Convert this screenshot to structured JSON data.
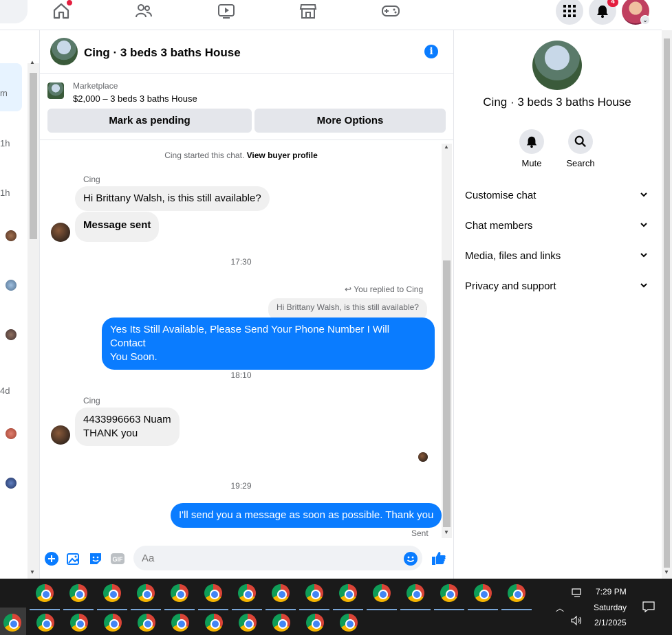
{
  "topnav": {
    "notification_count": "4",
    "icons": [
      "home-icon",
      "friends-icon",
      "watch-icon",
      "marketplace-icon",
      "gaming-icon",
      "menu-grid-icon",
      "bell-icon",
      "profile-avatar"
    ]
  },
  "left_list": {
    "times": [
      "m",
      "1h",
      "1h",
      "4d"
    ]
  },
  "chat": {
    "title": "Cing · 3 beds 3 baths House",
    "marketplace_label": "Marketplace",
    "listing_price": "$2,000 – 3 beds 3 baths House",
    "mark_pending_label": "Mark as pending",
    "more_options_label": "More Options",
    "started_text": "Cing started this chat.",
    "buyer_profile_link": "View buyer profile",
    "messages": {
      "sender1": "Cing",
      "in1": "Hi Brittany Walsh, is this still available?",
      "in2": "Message sent",
      "time1": "17:30",
      "replied_to": "You replied to Cing",
      "quoted": "Hi Brittany Walsh, is this still available?",
      "out1_line1": "Yes Its Still Available, Please Send Your Phone Number I Will Contact",
      "out1_line2": "You Soon.",
      "time2": "18:10",
      "sender2": "Cing",
      "in3_line1": "4433996663 Nuam",
      "in3_line2": "THANK you",
      "time3": "19:29",
      "out2": "I'll send you a message as soon as possible. Thank you",
      "status": "Sent"
    },
    "composer_placeholder": "Aa"
  },
  "right_panel": {
    "title": "Cing · 3 beds 3 baths House",
    "mute_label": "Mute",
    "search_label": "Search",
    "rows": [
      "Customise chat",
      "Chat members",
      "Media, files and links",
      "Privacy and support"
    ]
  },
  "taskbar": {
    "time": "7:29 PM",
    "day": "Saturday",
    "date": "2/1/2025"
  },
  "colors": {
    "accent": "#0a7cff",
    "bubble_in": "#f0f0f0",
    "badge": "#e41e3f",
    "taskbar": "#1a1a1a"
  }
}
